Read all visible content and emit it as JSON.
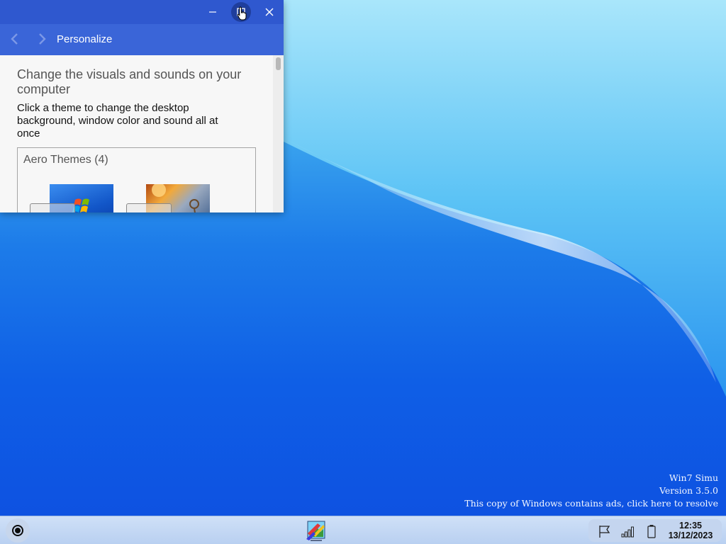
{
  "window": {
    "nav_title": "Personalize",
    "heading": "Change the visuals and sounds on your computer",
    "subtext": "Click a theme to change the desktop background, window color and sound all at once",
    "group_title": "Aero Themes (4)",
    "buttons": {
      "minimize_icon": "minimize-icon",
      "maximize_icon": "maximize-icon",
      "close_icon": "close-icon",
      "back_icon": "chevron-left-icon",
      "forward_icon": "chevron-right-icon"
    }
  },
  "watermark": {
    "line1": "Win7 Simu",
    "line2": "Version 3.5.0",
    "line3": "This copy of Windows contains ads, click here to resolve"
  },
  "taskbar": {
    "time": "12:35",
    "date": "13/12/2023",
    "tray_icons": [
      "flag-icon",
      "signal-icon",
      "battery-icon"
    ]
  },
  "colors": {
    "titlebar": "#2f58cf",
    "navbar": "#3a65d8",
    "desktop_accent": "#0f5fe6"
  }
}
